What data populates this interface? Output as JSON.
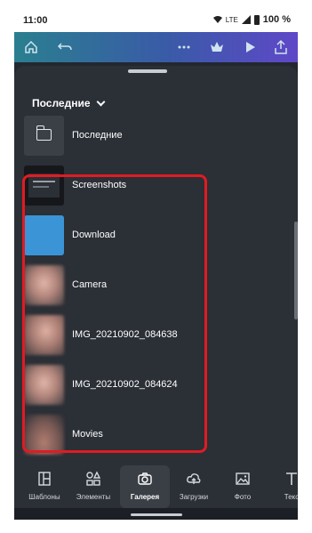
{
  "status_bar": {
    "time": "11:00",
    "network": "LTE",
    "battery": "100 %"
  },
  "toolbar": {
    "icons": [
      "home-icon",
      "undo-icon",
      "more-icon",
      "crown-icon",
      "play-icon",
      "share-icon"
    ]
  },
  "panel": {
    "dropdown_label": "Последние",
    "items": [
      {
        "label": "Последние",
        "thumb": "folder-icon"
      },
      {
        "label": "Screenshots",
        "thumb": "screenshot-thumbnail"
      },
      {
        "label": "Download",
        "thumb": "blue-thumbnail"
      },
      {
        "label": "Camera",
        "thumb": "photo-thumbnail"
      },
      {
        "label": "IMG_20210902_084638",
        "thumb": "photo-thumbnail"
      },
      {
        "label": "IMG_20210902_084624",
        "thumb": "photo-thumbnail"
      },
      {
        "label": "Movies",
        "thumb": "photo-thumbnail"
      }
    ]
  },
  "bottom_nav": {
    "items": [
      {
        "label": "Шаблоны",
        "icon": "templates-icon"
      },
      {
        "label": "Элементы",
        "icon": "elements-icon"
      },
      {
        "label": "Галерея",
        "icon": "camera-icon"
      },
      {
        "label": "Загрузки",
        "icon": "upload-cloud-icon"
      },
      {
        "label": "Фото",
        "icon": "photo-icon"
      },
      {
        "label": "Текс",
        "icon": "text-icon"
      }
    ],
    "active_index": 2
  },
  "colors": {
    "highlight": "#e11b22",
    "panel": "#2b2f36",
    "accent_blue": "#3a94d6"
  }
}
